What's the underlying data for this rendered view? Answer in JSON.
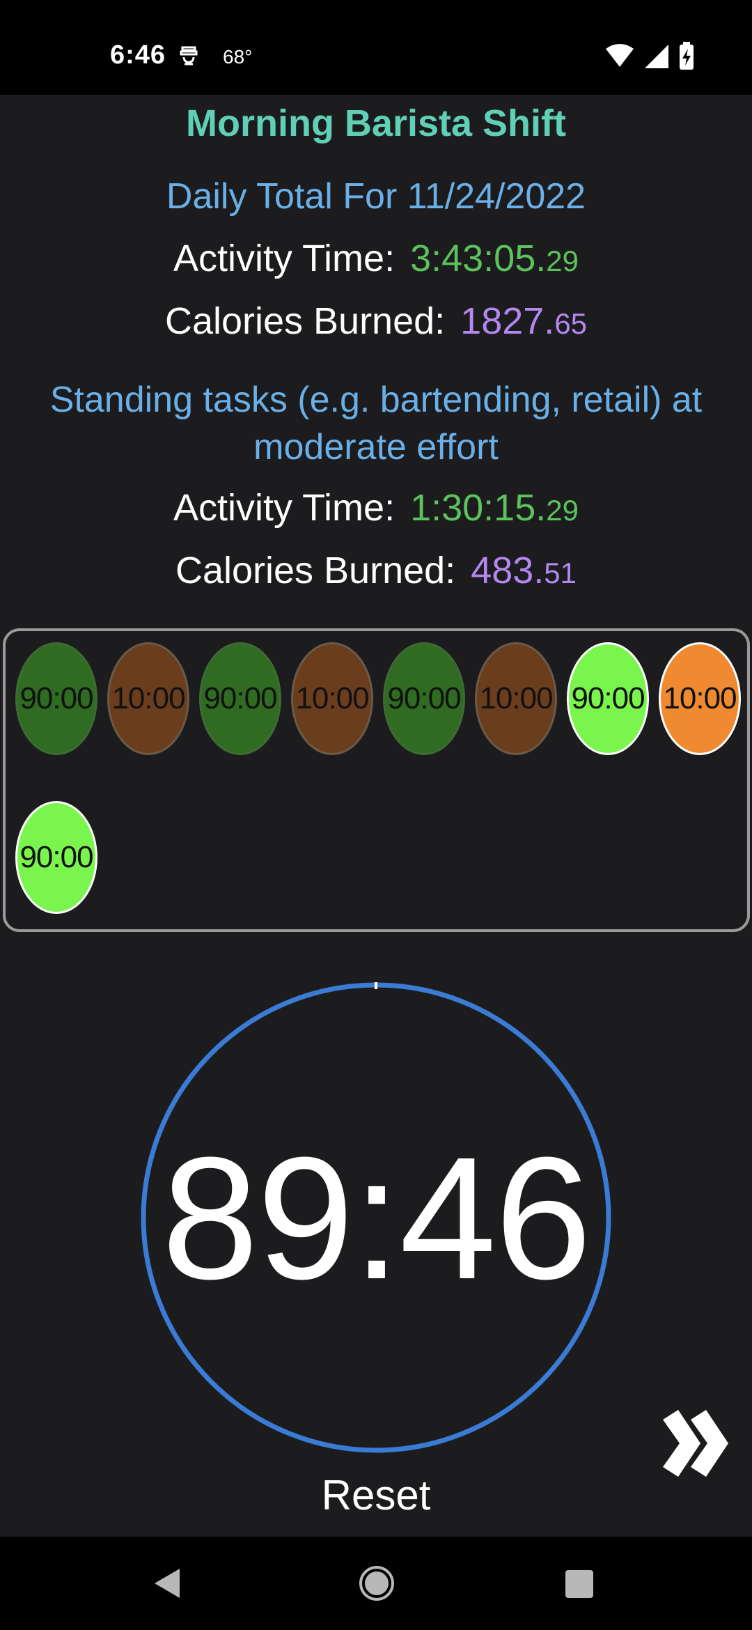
{
  "status_bar": {
    "time": "6:46",
    "temperature": "68°",
    "icons": [
      "wifi-icon",
      "cell-signal-icon",
      "battery-charging-icon"
    ]
  },
  "header": {
    "title": "Morning Barista Shift"
  },
  "daily_total": {
    "heading": "Daily Total For 11/24/2022",
    "activity_label": "Activity Time:",
    "activity_value": "3:43:05.",
    "activity_fraction": "29",
    "calories_label": "Calories Burned:",
    "calories_value": "1827.",
    "calories_fraction": "65"
  },
  "activity": {
    "heading": "Standing tasks (e.g. bartending, retail) at moderate effort",
    "activity_label": "Activity Time:",
    "activity_value": "1:30:15.",
    "activity_fraction": "29",
    "calories_label": "Calories Burned:",
    "calories_value": "483.",
    "calories_fraction": "51"
  },
  "intervals": [
    {
      "label": "90:00",
      "state": "done-work"
    },
    {
      "label": "10:00",
      "state": "done-rest"
    },
    {
      "label": "90:00",
      "state": "done-work"
    },
    {
      "label": "10:00",
      "state": "done-rest"
    },
    {
      "label": "90:00",
      "state": "done-work"
    },
    {
      "label": "10:00",
      "state": "done-rest"
    },
    {
      "label": "90:00",
      "state": "current-work"
    },
    {
      "label": "10:00",
      "state": "upcoming-rest"
    },
    {
      "label": "90:00",
      "state": "current-work"
    }
  ],
  "timer": {
    "display": "89:46"
  },
  "controls": {
    "reset_label": "Reset",
    "skip_icon": "double-chevron-right-icon"
  },
  "colors": {
    "title": "#5fd0b5",
    "section_heading": "#6ab0e8",
    "time_value": "#5cc35c",
    "calorie_value": "#b388f0",
    "ring": "#3a7bd5"
  }
}
